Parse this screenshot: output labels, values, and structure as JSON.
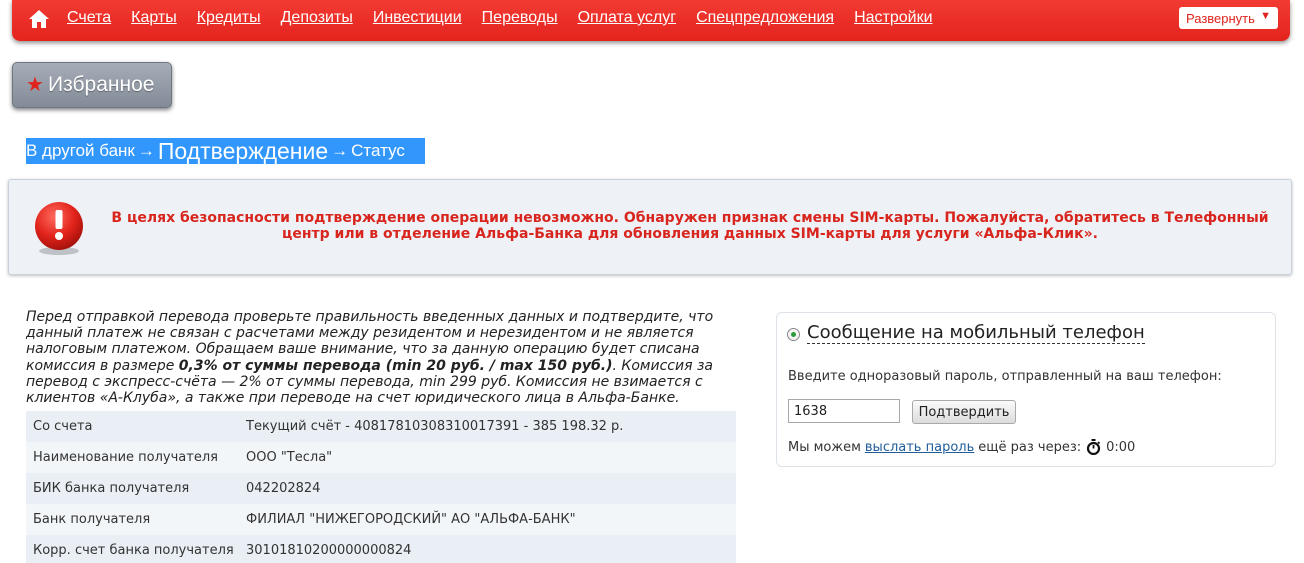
{
  "nav": {
    "links": [
      "Счета",
      "Карты",
      "Кредиты",
      "Депозиты",
      "Инвестиции",
      "Переводы",
      "Оплата услуг",
      "Спецпредложения",
      "Настройки"
    ],
    "expand_label": "Развернуть",
    "expand_arrow": "▼",
    "home_icon": "home-icon"
  },
  "favorites": {
    "label": "Избранное",
    "star": "★"
  },
  "breadcrumb": {
    "step1": "В другой банк",
    "arrow": "→",
    "step2": "Подтверждение",
    "step3": "Статус"
  },
  "alert": {
    "icon": "exclamation-icon",
    "text": "В целях безопасности подтверждение операции невозможно. Обнаружен признак смены SIM-карты. Пожалуйста, обратитесь в Телефонный центр или в отделение Альфа-Банка для обновления данных SIM-карты для услуги «Альфа-Клик»."
  },
  "disclaimer": {
    "part1": "Перед отправкой перевода проверьте правильность введенных данных и подтвердите, что данный платеж не связан с расчетами между резидентом и нерезидентом и не является налоговым платежом. Обращаем ваше внимание, что за данную операцию будет списана комиссия в размере ",
    "bold": "0,3% от суммы перевода (min 20 руб. / max 150 руб.)",
    "part2": ". Комиссия за перевод с экспресс-счёта — 2% от суммы перевода, min 299 руб. Комиссия не взимается с клиентов «А-Клуба», а также при переводе на счет юридического лица в Альфа-Банке."
  },
  "details": [
    {
      "label": "Со счета",
      "value": "Текущий счёт - 40817810308310017391 - 385 198.32 р."
    },
    {
      "label": "Наименование получателя",
      "value": "ООО \"Тесла\""
    },
    {
      "label": "БИК банка получателя",
      "value": "042202824"
    },
    {
      "label": "Банк получателя",
      "value": "ФИЛИАЛ \"НИЖЕГОРОДСКИЙ\" АО \"АЛЬФА-БАНК\""
    },
    {
      "label": "Корр. счет банка получателя",
      "value": "30101810200000000824"
    }
  ],
  "sms": {
    "title": "Сообщение на мобильный телефон",
    "prompt": "Введите одноразовый пароль, отправленный на ваш телефон:",
    "otp_value": "1638",
    "confirm_label": "Подтвердить",
    "resend_prefix": "Мы можем",
    "resend_link": "выслать пароль",
    "resend_suffix": "ещё раз через:",
    "timer": "0:00",
    "timer_icon": "stopwatch-icon"
  },
  "colors": {
    "brand_red": "#e3241d",
    "alert_text": "#d8261e",
    "selection_blue": "#3297fd",
    "link_blue": "#1f5c99"
  }
}
